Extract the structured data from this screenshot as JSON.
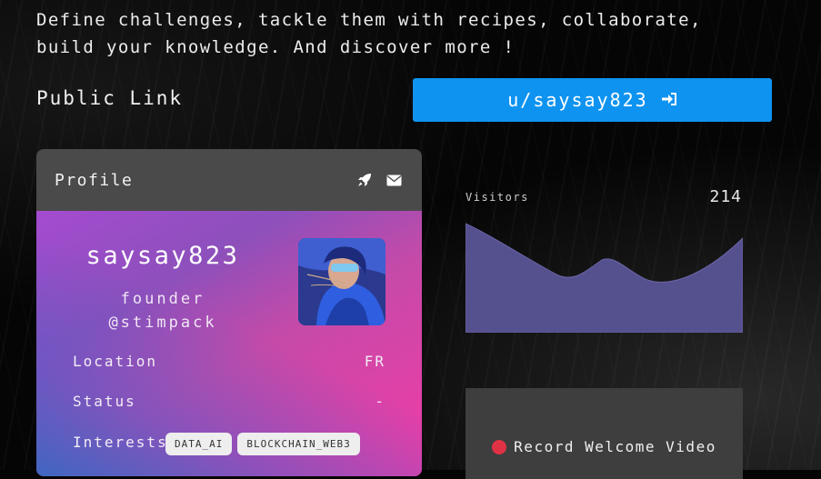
{
  "tagline": "Define challenges, tackle them with recipes, collaborate, build your knowledge. And discover more !",
  "public_link": {
    "label": "Public Link",
    "button_text": "u/saysay823",
    "icon": "sign-in-icon"
  },
  "profile_card": {
    "title": "Profile",
    "header_icons": [
      "rocket-icon",
      "envelope-icon"
    ],
    "username": "saysay823",
    "role_line1": "founder",
    "role_line2": "@stimpack",
    "location": {
      "label": "Location",
      "value": "FR"
    },
    "status": {
      "label": "Status",
      "value": "-"
    },
    "interests": {
      "label": "Interests",
      "tags": [
        "DATA_AI",
        "BLOCKCHAIN_WEB3"
      ]
    }
  },
  "visitors": {
    "label": "Visitors",
    "count": "214"
  },
  "video": {
    "record_label": "Record Welcome Video",
    "accent": "#e03245"
  },
  "colors": {
    "background": "#050505",
    "primary_button": "#0f93f0",
    "card_header": "#4a4a4a",
    "chart_fill": "#55508e"
  }
}
